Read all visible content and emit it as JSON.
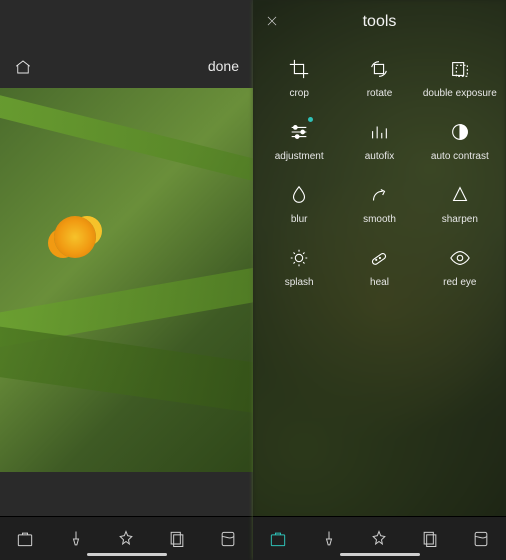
{
  "left": {
    "done_label": "done"
  },
  "right": {
    "title": "tools",
    "tools": [
      {
        "label": "crop"
      },
      {
        "label": "rotate"
      },
      {
        "label": "double exposure"
      },
      {
        "label": "adjustment"
      },
      {
        "label": "autofix"
      },
      {
        "label": "auto contrast"
      },
      {
        "label": "blur"
      },
      {
        "label": "smooth"
      },
      {
        "label": "sharpen"
      },
      {
        "label": "splash"
      },
      {
        "label": "heal"
      },
      {
        "label": "red eye"
      }
    ]
  }
}
